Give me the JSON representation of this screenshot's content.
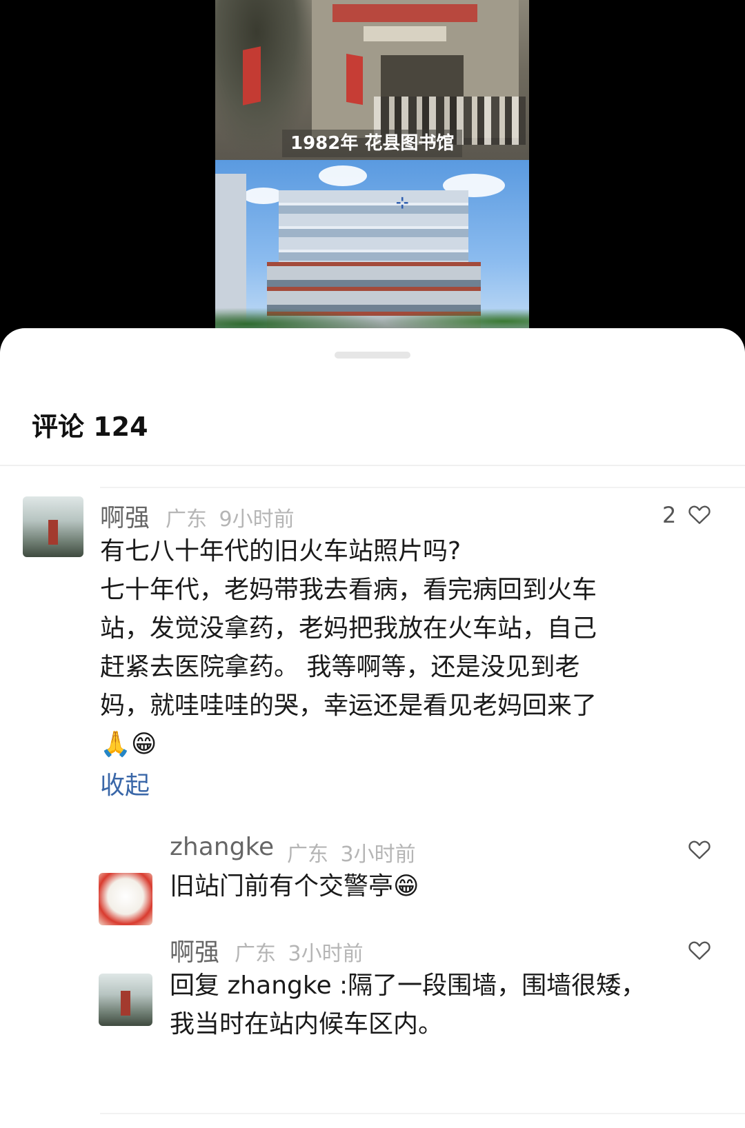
{
  "media": {
    "caption": "1982年 花县图书馆"
  },
  "sheet": {
    "title": "评论 124"
  },
  "comments": [
    {
      "user": "啊强",
      "region": "广东",
      "time": "9小时前",
      "likes": "2",
      "lines": [
        "有七八十年代的旧火车站照片吗?",
        "七十年代，老妈带我去看病，看完病回到火车",
        "站，发觉没拿药，老妈把我放在火车站，自己",
        "赶紧去医院拿药。 我等啊等，还是没见到老",
        "妈，就哇哇哇的哭，幸运还是看见老妈回来了",
        "🙏😁"
      ],
      "collapse_label": "收起"
    }
  ],
  "replies": [
    {
      "user": "zhangke",
      "region": "广东",
      "time": "3小时前",
      "lines": [
        "旧站门前有个交警亭😁"
      ]
    },
    {
      "user": "啊强",
      "region": "广东",
      "time": "3小时前",
      "lines": [
        "回复 zhangke :隔了一段围墙，围墙很矮，",
        "我当时在站内候车区内。"
      ]
    }
  ],
  "icons": {
    "heart": "heart-outline-icon"
  },
  "colors": {
    "link": "#3a67a8",
    "meta": "#b5b5b5",
    "name": "#666666"
  }
}
